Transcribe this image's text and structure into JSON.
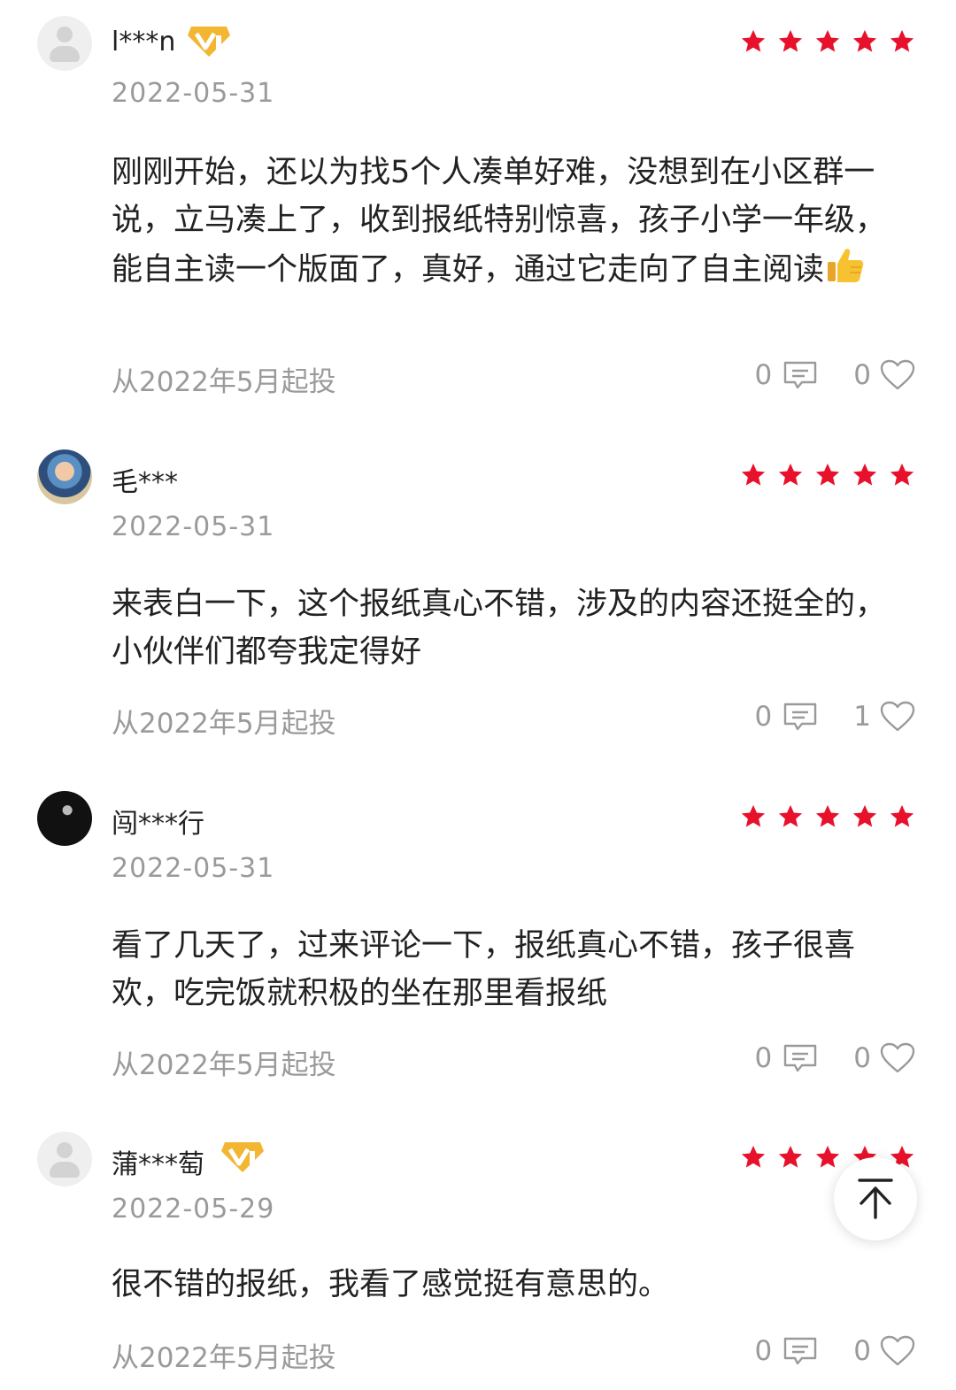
{
  "reviews": [
    {
      "user": "l***n",
      "vip": true,
      "avatar": "default-avatar",
      "date": "2022-05-31",
      "content": "刚刚开始，还以为找5个人凑单好难，没想到在小区群一说，立马凑上了，收到报纸特别惊喜，孩子小学一年级，能自主读一个版面了，真好，通过它走向了自主阅读",
      "emoji": "thumbs-up-icon",
      "since": "从2022年5月起投",
      "comments": "0",
      "likes": "0",
      "rating": 5
    },
    {
      "user": "毛***",
      "vip": false,
      "avatar": "photo-avatar",
      "date": "2022-05-31",
      "content": "来表白一下，这个报纸真心不错，涉及的内容还挺全的，小伙伴们都夸我定得好",
      "since": "从2022年5月起投",
      "comments": "0",
      "likes": "1",
      "rating": 5
    },
    {
      "user": "闯***行",
      "vip": false,
      "avatar": "photo-avatar",
      "date": "2022-05-31",
      "content": "看了几天了，过来评论一下，报纸真心不错，孩子很喜欢，吃完饭就积极的坐在那里看报纸",
      "since": "从2022年5月起投",
      "comments": "0",
      "likes": "0",
      "rating": 5
    },
    {
      "user": "蒲***萄",
      "vip": true,
      "avatar": "default-avatar",
      "date": "2022-05-29",
      "content": "很不错的报纸，我看了感觉挺有意思的。",
      "since": "从2022年5月起投",
      "comments": "0",
      "likes": "0",
      "rating": 5
    }
  ],
  "colors": {
    "star": "#e8112b",
    "muted": "#9a9a9a",
    "vip_gold": "#f2b632"
  },
  "back_to_top_icon": "arrow-up-icon"
}
